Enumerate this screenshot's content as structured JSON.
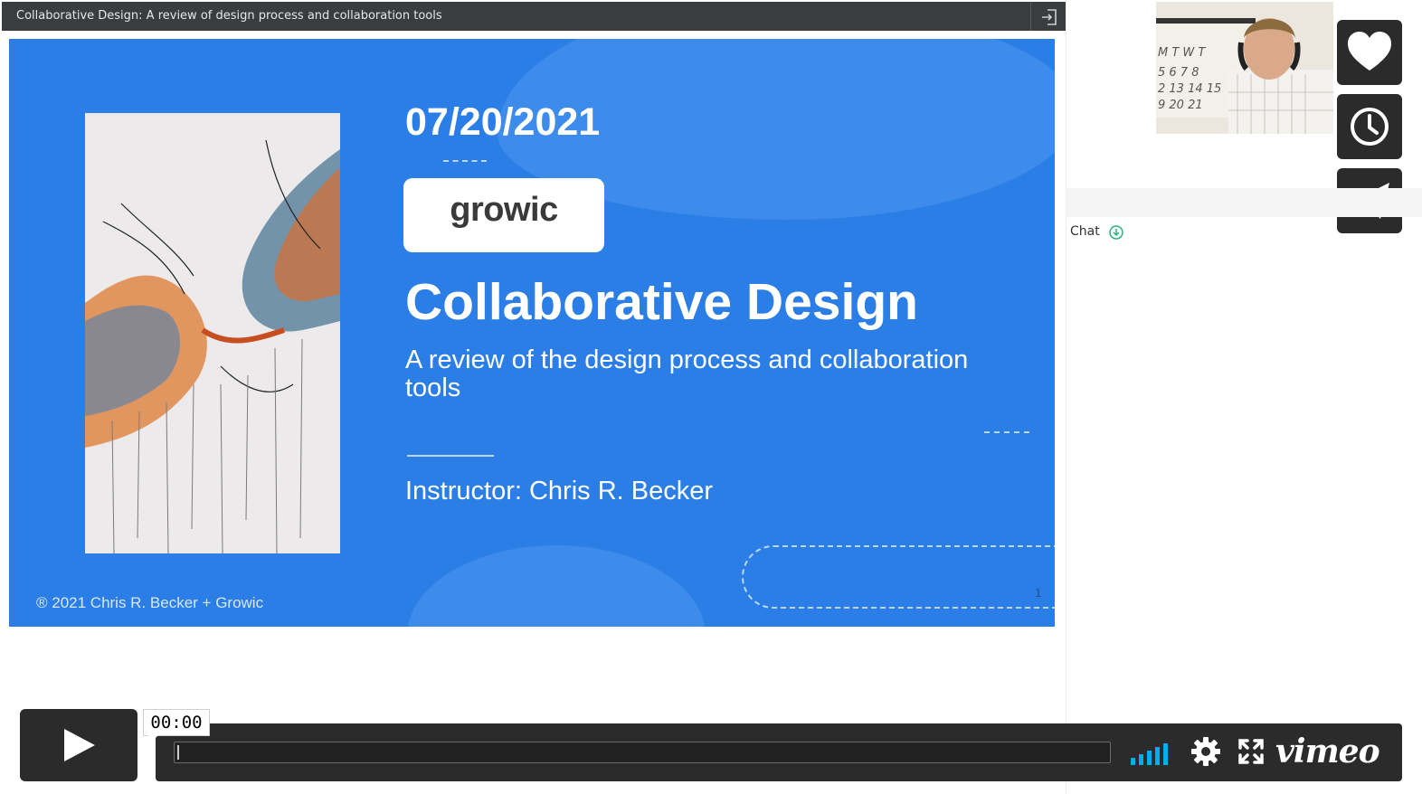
{
  "window": {
    "title": "Collaborative Design: A review of design process and collaboration tools"
  },
  "slide": {
    "date": "07/20/2021",
    "logo_text": "growic",
    "headline": "Collaborative Design",
    "subtitle": "A review of the design process and collaboration tools",
    "instructor": "Instructor: Chris R. Becker",
    "copyright": "® 2021 Chris R. Becker + Growic",
    "page_number": "1",
    "colors": {
      "background": "#2a7ee6",
      "accent_blob": "#3d8cec",
      "text": "#ffffff"
    }
  },
  "right_panel": {
    "chat_label": "Chat",
    "chat_icon": "download-circle-icon",
    "buttons": [
      {
        "name": "like-button",
        "icon": "heart-icon"
      },
      {
        "name": "watch-later-button",
        "icon": "clock-icon"
      },
      {
        "name": "share-button",
        "icon": "paper-plane-icon"
      }
    ]
  },
  "player": {
    "current_time": "00:00",
    "progress": 0,
    "brand": "vimeo",
    "volume_level": 1.0,
    "icons": [
      "play-icon",
      "volume-icon",
      "gear-icon",
      "fullscreen-icon"
    ],
    "colors": {
      "volume": "#00adef",
      "bar": "#2b2b2b"
    }
  }
}
